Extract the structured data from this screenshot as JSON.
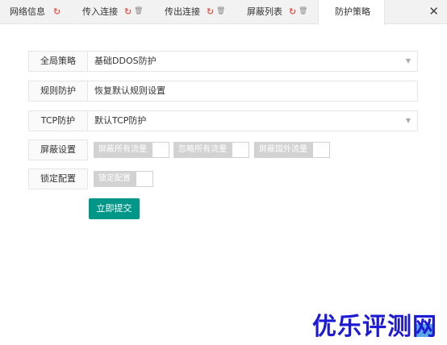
{
  "tabs": [
    {
      "label": "网络信息",
      "refresh_icon": true,
      "trash_icon": false
    },
    {
      "label": "传入连接",
      "refresh_icon": true,
      "trash_icon": true
    },
    {
      "label": "传出连接",
      "refresh_icon": true,
      "trash_icon": true
    },
    {
      "label": "屏蔽列表",
      "refresh_icon": true,
      "trash_icon": true
    },
    {
      "label": "防护策略",
      "active": true
    }
  ],
  "close_glyph": "✕",
  "icons": {
    "refresh": "↻",
    "trash": "🗑",
    "caret": "▼"
  },
  "form": {
    "global_policy": {
      "label": "全局策略",
      "value": "基础DDOS防护"
    },
    "rule_protect": {
      "label": "规则防护",
      "value": "恢复默认规则设置"
    },
    "tcp_protect": {
      "label": "TCP防护",
      "value": "默认TCP防护"
    },
    "block_settings": {
      "label": "屏蔽设置",
      "switches": [
        {
          "text": "屏蔽所有流量",
          "on": false
        },
        {
          "text": "忽略所有流量",
          "on": false
        },
        {
          "text": "屏蔽国外流量",
          "on": false
        }
      ]
    },
    "lock_config": {
      "label": "锁定配置",
      "switches": [
        {
          "text": "锁定配置",
          "on": false
        }
      ]
    },
    "submit_label": "立即提交"
  },
  "watermark": "优乐评测网",
  "colors": {
    "accent": "#009688",
    "refresh": "#e05a4e",
    "switch_off": "#d2d2d2",
    "watermark": "#1d1ad6"
  }
}
